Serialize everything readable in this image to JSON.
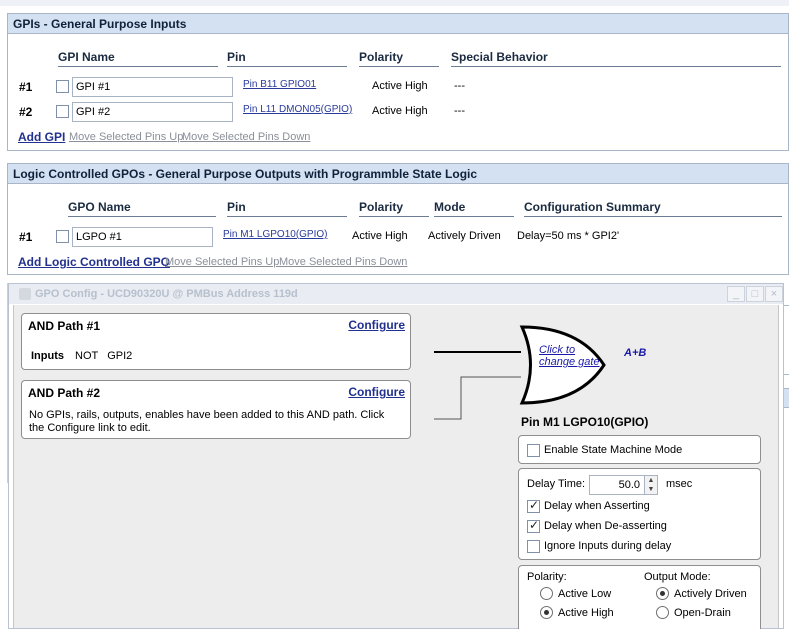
{
  "gpi_panel": {
    "title": "GPIs - General Purpose Inputs",
    "headers": {
      "name": "GPI Name",
      "pin": "Pin",
      "polarity": "Polarity",
      "special": "Special Behavior"
    },
    "rows": [
      {
        "num": "#1",
        "name": "GPI #1",
        "pin": "Pin B11 GPIO01",
        "polarity": "Active High",
        "special": "---"
      },
      {
        "num": "#2",
        "name": "GPI #2",
        "pin": "Pin L11 DMON05(GPIO)",
        "polarity": "Active High",
        "special": "---"
      }
    ],
    "actions": {
      "add": "Add GPI",
      "up": "Move Selected Pins Up",
      "down": "Move Selected Pins Down"
    }
  },
  "gpo_panel": {
    "title": "Logic Controlled GPOs - General Purpose Outputs with Programmble State Logic",
    "headers": {
      "name": "GPO Name",
      "pin": "Pin",
      "polarity": "Polarity",
      "mode": "Mode",
      "summary": "Configuration Summary"
    },
    "rows": [
      {
        "num": "#1",
        "name": "LGPO #1",
        "pin": "Pin M1 LGPO10(GPIO)",
        "polarity": "Active High",
        "mode": "Actively Driven",
        "summary": "Delay=50 ms * GPI2'"
      }
    ],
    "actions": {
      "add": "Add Logic Controlled GPO",
      "up": "Move Selected Pins Up",
      "down": "Move Selected Pins Down"
    }
  },
  "dialog": {
    "title": "GPO Config - UCD90320U @ PMBus Address 119d",
    "title_buttons": {
      "minimize": "_",
      "maximize": "□",
      "close": "×"
    },
    "and_path_1": {
      "title": "AND Path #1",
      "configure": "Configure",
      "inputs_label": "Inputs",
      "inputs_value": "NOT   GPI2"
    },
    "and_path_2": {
      "title": "AND Path #2",
      "configure": "Configure",
      "message": "No GPIs, rails, outputs, enables have been added to this AND path. Click the Configure link to edit."
    },
    "gate": {
      "link_line1": "Click to",
      "link_line2": "change gate",
      "expression": "A+B"
    },
    "pin_label": "Pin M1 LGPO10(GPIO)",
    "state_machine": {
      "label": "Enable State Machine Mode",
      "checked": false
    },
    "delay": {
      "label": "Delay Time:",
      "value": "50.0",
      "unit": "msec",
      "when_asserting": {
        "label": "Delay when Asserting",
        "checked": true
      },
      "when_deasserting": {
        "label": "Delay when De-asserting",
        "checked": true
      },
      "ignore_inputs": {
        "label": "Ignore Inputs during delay",
        "checked": false
      }
    },
    "polarity": {
      "label": "Polarity:",
      "options": [
        "Active Low",
        "Active High"
      ],
      "selected": "Active High"
    },
    "output_mode": {
      "label": "Output Mode:",
      "options": [
        "Actively Driven",
        "Open-Drain"
      ],
      "selected": "Actively Driven"
    }
  },
  "colors": {
    "panel_title_bg": "#d4e1f3",
    "link": "#22318f",
    "gate_text": "#1a1aa8",
    "disabled_link": "#8a8f98"
  }
}
